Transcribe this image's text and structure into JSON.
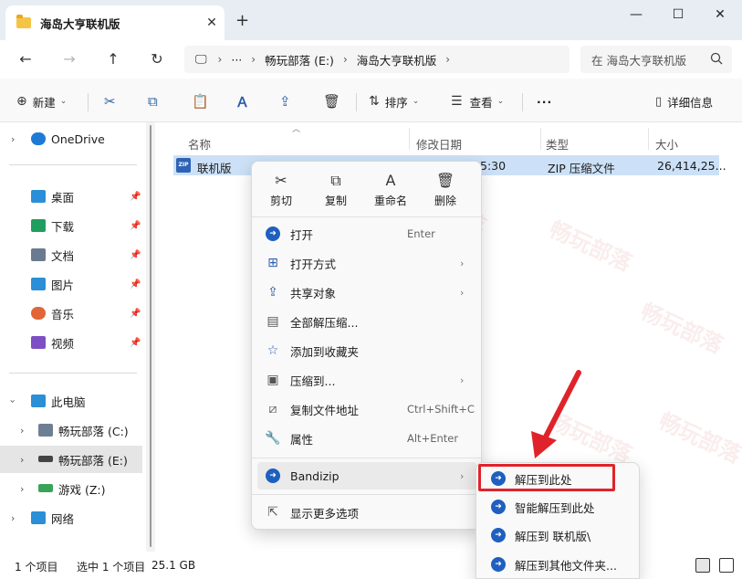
{
  "window": {
    "tab_title": "海岛大亨联机版",
    "tab_close": "✕",
    "new_tab": "+",
    "minimize": "—",
    "maximize": "☐",
    "close": "✕"
  },
  "nav": {
    "back": "←",
    "forward": "→",
    "up": "↑",
    "refresh": "↻",
    "computer_icon": "🖵",
    "ellipsis": "···",
    "breadcrumbs": [
      "畅玩部落 (E:)",
      "海岛大亨联机版"
    ],
    "chevron": "›",
    "search_placeholder": "在 海岛大亨联机版",
    "search_icon": "search-icon"
  },
  "toolbar": {
    "new_label": "新建",
    "sort_label": "排序",
    "view_label": "查看",
    "more_label": "···",
    "details_label": "详细信息",
    "caret": "⌄"
  },
  "sidebar": {
    "onedrive": "OneDrive",
    "quick": [
      {
        "label": "桌面",
        "icon": "desktop-icon",
        "color": "#2a8fd6"
      },
      {
        "label": "下载",
        "icon": "download-icon",
        "color": "#1f9e60"
      },
      {
        "label": "文档",
        "icon": "document-icon",
        "color": "#6b7a8f"
      },
      {
        "label": "图片",
        "icon": "pictures-icon",
        "color": "#2a8fd6"
      },
      {
        "label": "音乐",
        "icon": "music-icon",
        "color": "#e0663a"
      },
      {
        "label": "视频",
        "icon": "video-icon",
        "color": "#7d4fc4"
      }
    ],
    "this_pc": "此电脑",
    "drives": [
      {
        "label": "畅玩部落 (C:)",
        "icon": "drive-c-icon"
      },
      {
        "label": "畅玩部落 (E:)",
        "icon": "drive-e-icon"
      },
      {
        "label": "游戏 (Z:)",
        "icon": "drive-z-icon"
      }
    ],
    "network": "网络"
  },
  "columns": {
    "name": "名称",
    "modified": "修改日期",
    "type": "类型",
    "size": "大小"
  },
  "file": {
    "name": "联机版",
    "modified_partial": "5:30",
    "type": "ZIP 压缩文件",
    "size": "26,414,25...",
    "icon_text": "ZIP"
  },
  "context_menu": {
    "quick_actions": [
      {
        "label": "剪切",
        "icon": "cut-icon",
        "glyph": "✂"
      },
      {
        "label": "复制",
        "icon": "copy-icon",
        "glyph": "⧉"
      },
      {
        "label": "重命名",
        "icon": "rename-icon",
        "glyph": "A"
      },
      {
        "label": "删除",
        "icon": "delete-icon",
        "glyph": "🗑"
      }
    ],
    "items": [
      {
        "label": "打开",
        "shortcut": "Enter",
        "arrow": false,
        "icon": "open-icon"
      },
      {
        "label": "打开方式",
        "shortcut": "",
        "arrow": true,
        "icon": "open-with-icon"
      },
      {
        "label": "共享对象",
        "shortcut": "",
        "arrow": true,
        "icon": "share-icon"
      },
      {
        "label": "全部解压缩...",
        "shortcut": "",
        "arrow": false,
        "icon": "extract-all-icon"
      },
      {
        "label": "添加到收藏夹",
        "shortcut": "",
        "arrow": false,
        "icon": "star-icon"
      },
      {
        "label": "压缩到...",
        "shortcut": "",
        "arrow": true,
        "icon": "compress-icon"
      },
      {
        "label": "复制文件地址",
        "shortcut": "Ctrl+Shift+C",
        "arrow": false,
        "icon": "copy-path-icon"
      },
      {
        "label": "属性",
        "shortcut": "Alt+Enter",
        "arrow": false,
        "icon": "properties-icon"
      }
    ],
    "bandizip": "Bandizip",
    "more_options": "显示更多选项",
    "arrow": "›"
  },
  "submenu": {
    "items": [
      "解压到此处",
      "智能解压到此处",
      "解压到 联机版\\",
      "解压到其他文件夹..."
    ]
  },
  "status": {
    "count": "1 个项目",
    "selected": "选中 1 个项目",
    "size": "25.1 GB"
  },
  "watermark": "畅玩部落",
  "colors": {
    "accent": "#2b5ea8",
    "selection": "#cce1f7",
    "highlight_box": "#e0232a"
  }
}
